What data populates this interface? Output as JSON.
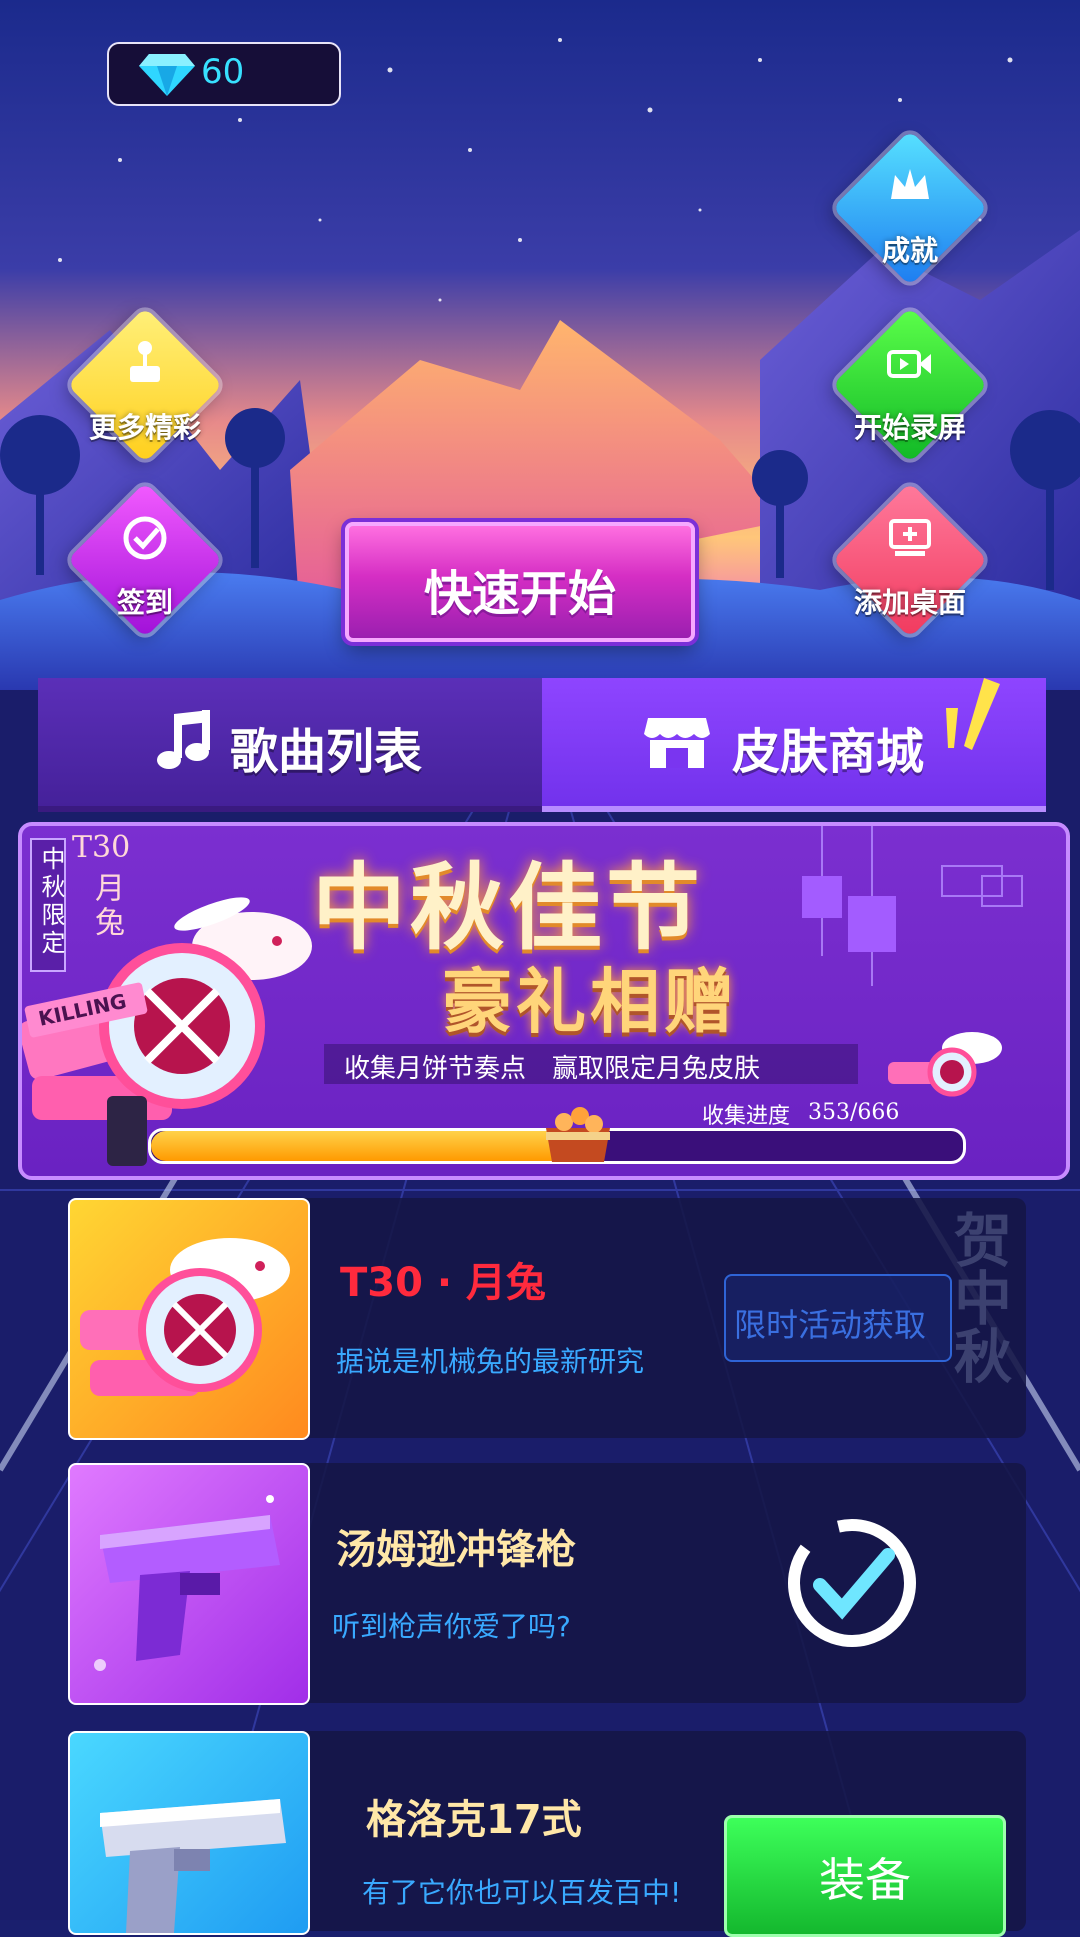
{
  "currency": {
    "icon": "diamond-icon",
    "count": "60"
  },
  "side_buttons": {
    "more": "更多精彩",
    "checkin": "签到",
    "achievement": "成就",
    "record": "开始录屏",
    "add_desktop": "添加桌面"
  },
  "quick_start": "快速开始",
  "tabs": [
    {
      "label": "歌曲列表",
      "icon": "music-note-icon",
      "active": false
    },
    {
      "label": "皮肤商城",
      "icon": "shop-icon",
      "active": true
    }
  ],
  "banner": {
    "badge_vertical": "中秋限定",
    "skin_code": "T30",
    "skin_name_vertical": "月兔",
    "title": "中秋佳节",
    "subtitle": "豪礼相赠",
    "description": "收集月饼节奏点　赢取限定月兔皮肤",
    "progress_label": "收集进度",
    "progress_value": "353/666",
    "progress_fraction": 0.53,
    "gun_text": "KILLING"
  },
  "skins": [
    {
      "name": "T30 · 月兔",
      "desc": "据说是机械兔的最新研究",
      "action": "限时活动获取",
      "stamp": "贺中秋",
      "name_color": "#ff2a3d"
    },
    {
      "name": "汤姆逊冲锋枪",
      "desc": "听到枪声你爱了吗?",
      "action": "selected-check-icon",
      "name_color": "#ffe7a8"
    },
    {
      "name": "格洛克17式",
      "desc": "有了它你也可以百发百中!",
      "action": "装备",
      "name_color": "#ffe7a8"
    }
  ],
  "colors": {
    "accent_purple": "#7b2fd8",
    "equip_green": "#2fd14a",
    "progress_orange": "#ffab00"
  }
}
